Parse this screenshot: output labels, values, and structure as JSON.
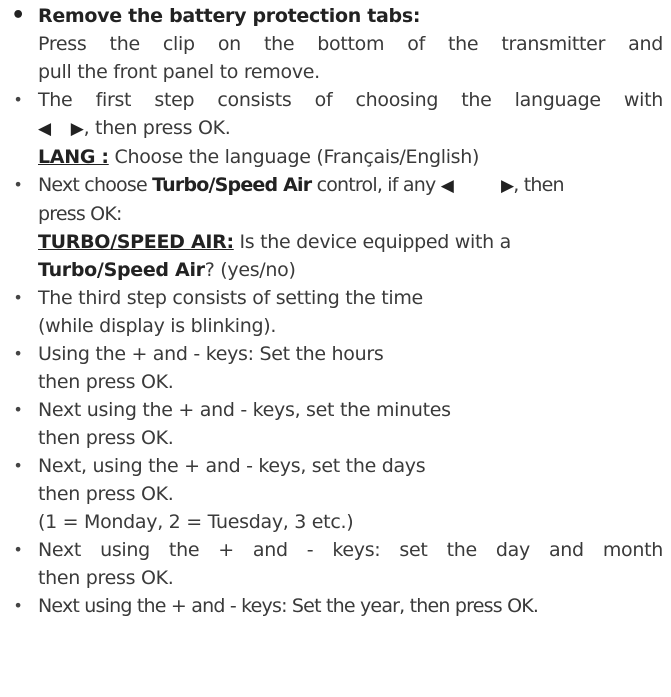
{
  "instructions": {
    "item1": {
      "title": "Remove the battery protection tabs:",
      "line1": "Press the clip on the bottom of the transmitter and",
      "line2": "pull the front panel to remove."
    },
    "item2": {
      "line1": "The first step consists of choosing the language with",
      "arrow_left": "◀",
      "arrow_right": "▶",
      "line2_text": ", then press OK.",
      "label": "LANG :",
      "label_text": "Choose the language (Français/English)"
    },
    "item3": {
      "text1": "Next choose",
      "bold1": "Turbo/Speed Air",
      "text2": "control, if any",
      "arrow_left": "◀",
      "arrow_right": "▶",
      "text3": ", then",
      "line2": "press OK:",
      "label": "TURBO/SPEED AIR:",
      "label_text": "Is the device equipped with a",
      "bold2": "Turbo/Speed Air",
      "question": "? (yes/no)"
    },
    "item4": {
      "line1": "The third step consists of setting the time",
      "line2": "(while display is blinking)."
    },
    "item5": {
      "line1": "Using the + and - keys: Set the hours",
      "line2": "then press OK."
    },
    "item6": {
      "line1": "Next using the + and - keys, set the minutes",
      "line2": "then press OK."
    },
    "item7": {
      "line1": "Next, using the + and - keys, set the days",
      "line2": "then press OK.",
      "line3": "(1 = Monday, 2 = Tuesday, 3 etc.)"
    },
    "item8": {
      "line1": "Next using the + and - keys: set the day and month",
      "line2": "then press OK."
    },
    "item9": {
      "line1": "Next using the + and - keys: Set the year, then press OK."
    }
  },
  "bullets": {
    "big": "•",
    "small": "•"
  }
}
